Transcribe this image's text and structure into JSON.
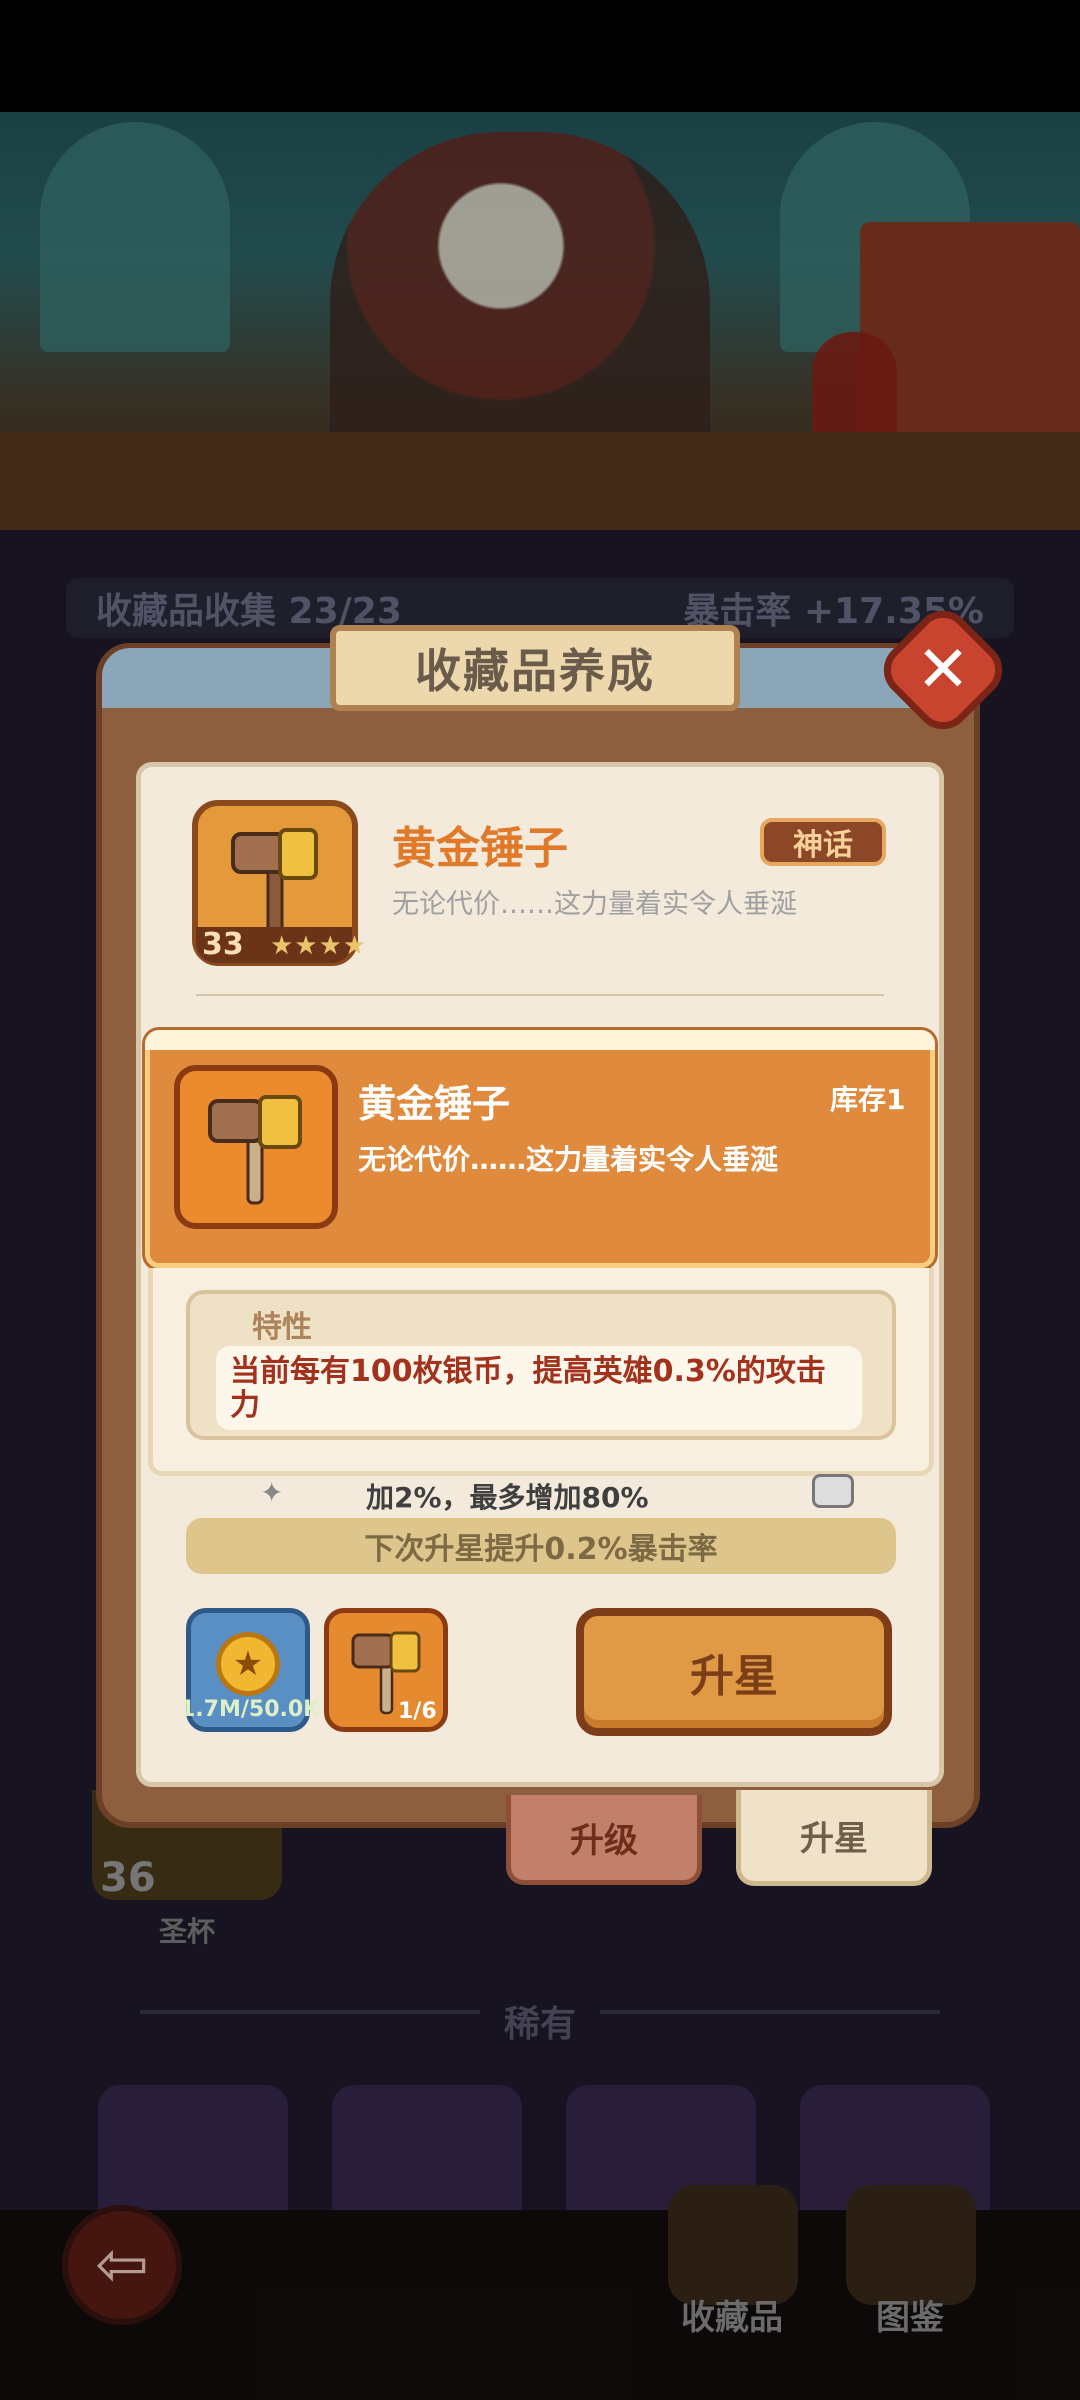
{
  "background": {
    "stats_bar": {
      "left": "收藏品收集 23/23",
      "right": "暴击率 +17.35%"
    },
    "grail": {
      "level": "36",
      "label": "圣杯"
    },
    "rare_section_label": "稀有",
    "bottom_nav": {
      "collections_label": "收藏品",
      "illustrations_label": "图鉴"
    }
  },
  "panel": {
    "title": "收藏品养成",
    "item": {
      "name": "黄金锤子",
      "rarity_badge": "神话",
      "description": "无论代价……这力量着实令人垂涎",
      "level": "33",
      "stars": "★★★★"
    },
    "popup": {
      "name": "黄金锤子",
      "stock": "库存1",
      "description": "无论代价……这力量着实令人垂涎",
      "trait_title": "特性",
      "trait_text": "当前每有100枚银币，提高英雄0.3%的攻击力"
    },
    "partial_text": "加2%，最多增加80%",
    "next_upgrade": "下次升星提升0.2%暴击率",
    "costs": {
      "coin_amount": "1.7M/50.0K",
      "item_count": "1/6"
    },
    "star_up_button": "升星",
    "tabs": {
      "upgrade": "升级",
      "star_up": "升星"
    }
  },
  "colors": {
    "accent_orange": "#e08a3e",
    "trait_red": "#a2321d",
    "panel_cream": "#f3eadc"
  }
}
